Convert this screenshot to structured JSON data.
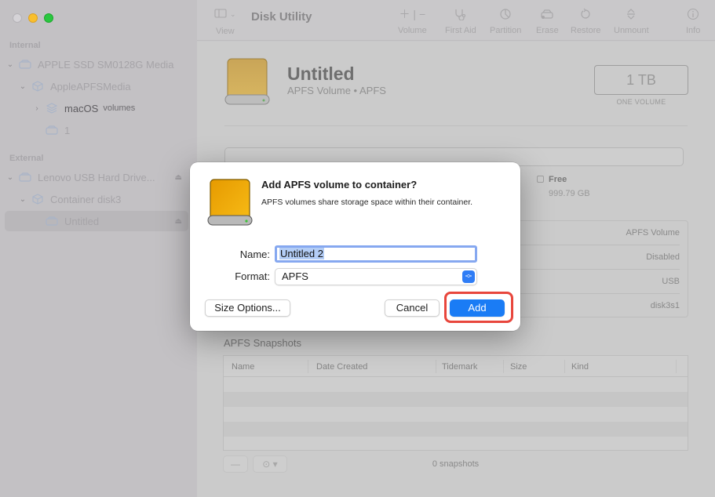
{
  "window": {
    "traffic_lights": [
      "close",
      "minimize",
      "maximize"
    ]
  },
  "sidebar": {
    "sections": [
      {
        "label": "Internal",
        "items": [
          {
            "label": "APPLE SSD SM0128G Media",
            "icon": "drive-icon",
            "expanded": true,
            "level": 0
          },
          {
            "label": "AppleAPFSMedia",
            "icon": "container-icon",
            "expanded": true,
            "level": 1
          },
          {
            "label": "macOS",
            "sublabel": "volumes",
            "icon": "volumes-stack-icon",
            "expanded": false,
            "level": 2
          },
          {
            "label": "1",
            "icon": "volume-icon",
            "level": 2
          }
        ]
      },
      {
        "label": "External",
        "items": [
          {
            "label": "Lenovo USB Hard Drive...",
            "icon": "drive-icon",
            "expanded": true,
            "level": 0,
            "eject": true
          },
          {
            "label": "Container disk3",
            "icon": "container-icon",
            "expanded": true,
            "level": 1
          },
          {
            "label": "Untitled",
            "icon": "volume-icon",
            "level": 2,
            "selected": true,
            "eject": true
          }
        ]
      }
    ]
  },
  "toolbar": {
    "view_label": "View",
    "title": "Disk Utility",
    "buttons": [
      {
        "label": "Volume",
        "icon": "plus-minus-icon"
      },
      {
        "label": "First Aid",
        "icon": "stethoscope-icon"
      },
      {
        "label": "Partition",
        "icon": "pie-icon"
      },
      {
        "label": "Erase",
        "icon": "erase-drive-icon"
      },
      {
        "label": "Restore",
        "icon": "restore-icon"
      },
      {
        "label": "Unmount",
        "icon": "unmount-icon"
      },
      {
        "label": "Info",
        "icon": "info-icon"
      }
    ]
  },
  "volume": {
    "name": "Untitled",
    "description": "APFS Volume • APFS",
    "size": "1 TB",
    "size_caption": "ONE VOLUME",
    "free_label": "Free",
    "free_value": "999.79 GB",
    "info_values": [
      "APFS Volume",
      "Disabled",
      "USB",
      "disk3s1"
    ]
  },
  "snapshots": {
    "title": "APFS Snapshots",
    "columns": [
      "Name",
      "Date Created",
      "Tidemark",
      "Size",
      "Kind"
    ],
    "rows": [],
    "count_label": "0 snapshots",
    "remove_label": "—",
    "more_label": "⊙ ▾"
  },
  "dialog": {
    "title": "Add APFS volume to container?",
    "message": "APFS volumes share storage space within their container.",
    "name_label": "Name:",
    "name_value": "Untitled 2",
    "format_label": "Format:",
    "format_value": "APFS",
    "size_options_label": "Size Options...",
    "cancel_label": "Cancel",
    "add_label": "Add",
    "highlight_color": "#e8463c",
    "accent_color": "#1a7cf5"
  }
}
